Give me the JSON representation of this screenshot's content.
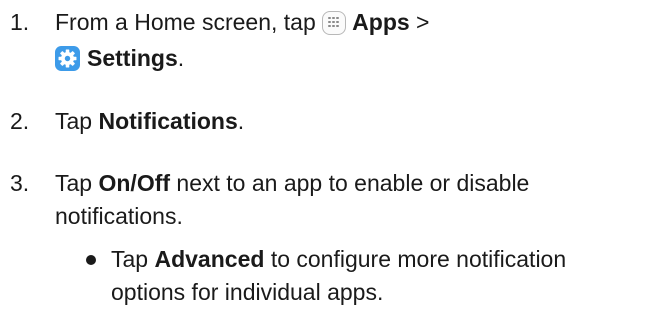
{
  "steps": [
    {
      "number": "1.",
      "line1_prefix": "From a Home screen, tap",
      "apps_label": "Apps",
      "separator": ">",
      "settings_label": "Settings",
      "line2_suffix": "."
    },
    {
      "number": "2.",
      "prefix": "Tap",
      "bold": "Notifications",
      "suffix": "."
    },
    {
      "number": "3.",
      "prefix": "Tap",
      "bold": "On/Off",
      "rest_line1": "next to an app to enable or disable",
      "line2": "notifications."
    }
  ],
  "bullet": {
    "prefix": "Tap",
    "bold": "Advanced",
    "rest_line1": "to configure more notification",
    "line2": "options for individual apps."
  },
  "icons": {
    "apps": "apps-icon",
    "settings": "settings-gear-icon",
    "settings_color": "#3d9be9"
  }
}
